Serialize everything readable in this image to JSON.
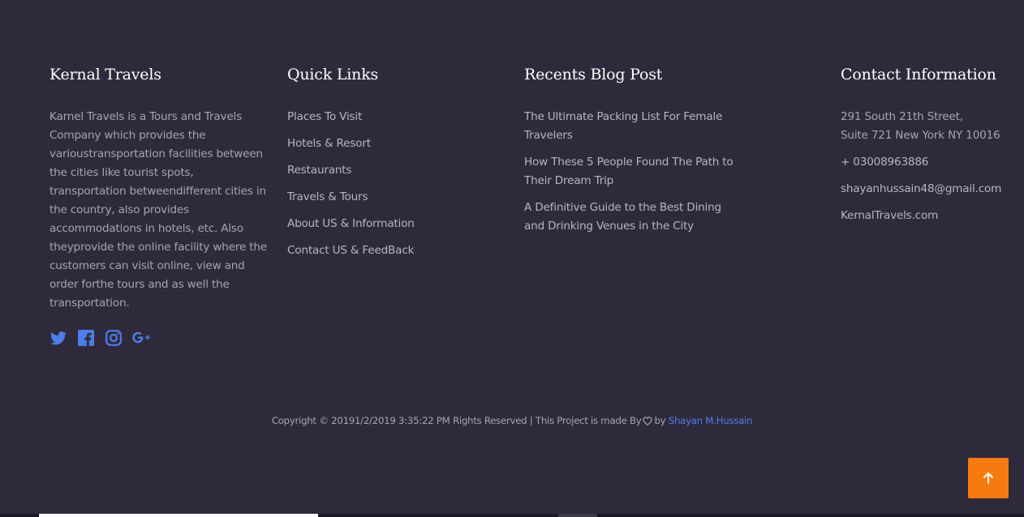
{
  "about": {
    "title": "Kernal Travels",
    "description": "Karnel Travels is a Tours and Travels Company which provides the varioustransportation facilities between the cities like tourist spots, transportation betweendifferent cities in the country, also provides accommodations in hotels, etc. Also theyprovide the online facility where the customers can visit online, view and order forthe tours and as well the transportation.",
    "social": [
      {
        "name": "twitter-icon"
      },
      {
        "name": "facebook-icon"
      },
      {
        "name": "instagram-icon"
      },
      {
        "name": "google-plus-icon"
      }
    ]
  },
  "quick_links": {
    "title": "Quick Links",
    "items": [
      "Places To Visit",
      "Hotels & Resort",
      "Restaurants",
      "Travels & Tours",
      "About US & Information",
      "Contact US & FeedBack"
    ]
  },
  "blog": {
    "title": "Recents Blog Post",
    "items": [
      "The Ultimate Packing List For Female Travelers",
      "How These 5 People Found The Path to Their Dream Trip",
      "A Definitive Guide to the Best Dining and Drinking Venues in the City"
    ]
  },
  "contact": {
    "title": "Contact Information",
    "address_line1": "291 South 21th Street,",
    "address_line2": "Suite 721 New York NY 10016",
    "phone": "+ 03008963886",
    "email": "shayanhussain48@gmail.com",
    "website": "KernalTravels.com"
  },
  "copyright": {
    "prefix": "Copyright © 20191/2/2019 3:35:22 PM Rights Reserved | This Project is made By",
    "by": "by",
    "author": "Shayan M.Hussain"
  },
  "colors": {
    "background": "#2f2a3b",
    "accent_blue": "#4e7de9",
    "back_to_top": "#f57b10"
  }
}
